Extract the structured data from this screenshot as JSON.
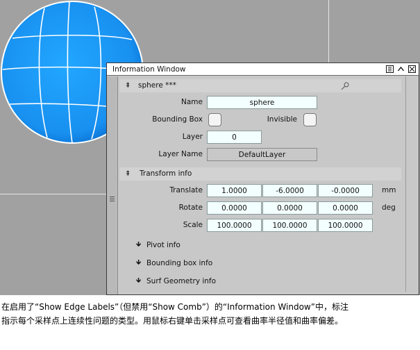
{
  "viewport": {
    "background_color": "#a1a1a1",
    "sphere_color": "#1e90ff"
  },
  "window": {
    "title": "Information Window",
    "buttons": [
      "list-icon",
      "collapse-up-icon",
      "close-icon"
    ]
  },
  "object_section": {
    "header": "sphere ***",
    "name_label": "Name",
    "name_value": "sphere",
    "bbox_label": "Bounding Box",
    "invisible_label": "Invisible",
    "layer_label": "Layer",
    "layer_value": "0",
    "layer_name_label": "Layer Name",
    "layer_name_value": "DefaultLayer"
  },
  "transform_section": {
    "header": "Transform info",
    "translate": {
      "label": "Translate",
      "x": "1.0000",
      "y": "-6.0000",
      "z": "-0.0000",
      "unit": "mm"
    },
    "rotate": {
      "label": "Rotate",
      "x": "0.0000",
      "y": "0.0000",
      "z": "0.0000",
      "unit": "deg"
    },
    "scale": {
      "label": "Scale",
      "x": "100.0000",
      "y": "100.0000",
      "z": "100.0000"
    }
  },
  "collapsed_sections": {
    "pivot": "Pivot info",
    "bounding_box": "Bounding box info",
    "surf_geometry": "Surf Geometry info"
  },
  "caption": {
    "line1": "在启用了“Show Edge Labels”（但禁用“Show Comb”）的“Information Window”中，标注",
    "line2": "指示每个采样点上连续性问题的类型。用鼠标右键单击采样点可查看曲率半径值和曲率偏差。"
  }
}
